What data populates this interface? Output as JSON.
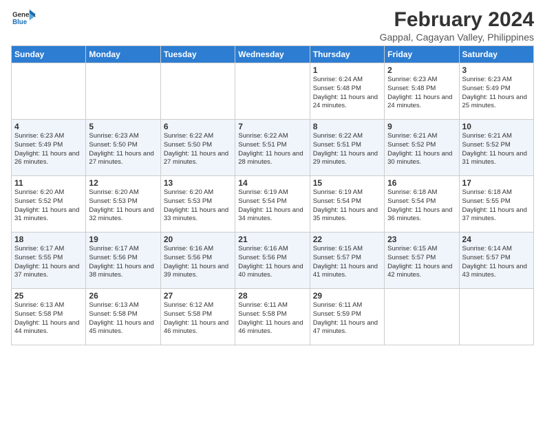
{
  "header": {
    "logo_line1": "General",
    "logo_line2": "Blue",
    "title": "February 2024",
    "subtitle": "Gappal, Cagayan Valley, Philippines"
  },
  "days_of_week": [
    "Sunday",
    "Monday",
    "Tuesday",
    "Wednesday",
    "Thursday",
    "Friday",
    "Saturday"
  ],
  "weeks": [
    [
      {
        "day": "",
        "info": ""
      },
      {
        "day": "",
        "info": ""
      },
      {
        "day": "",
        "info": ""
      },
      {
        "day": "",
        "info": ""
      },
      {
        "day": "1",
        "info": "Sunrise: 6:24 AM\nSunset: 5:48 PM\nDaylight: 11 hours and 24 minutes."
      },
      {
        "day": "2",
        "info": "Sunrise: 6:23 AM\nSunset: 5:48 PM\nDaylight: 11 hours and 24 minutes."
      },
      {
        "day": "3",
        "info": "Sunrise: 6:23 AM\nSunset: 5:49 PM\nDaylight: 11 hours and 25 minutes."
      }
    ],
    [
      {
        "day": "4",
        "info": "Sunrise: 6:23 AM\nSunset: 5:49 PM\nDaylight: 11 hours and 26 minutes."
      },
      {
        "day": "5",
        "info": "Sunrise: 6:23 AM\nSunset: 5:50 PM\nDaylight: 11 hours and 27 minutes."
      },
      {
        "day": "6",
        "info": "Sunrise: 6:22 AM\nSunset: 5:50 PM\nDaylight: 11 hours and 27 minutes."
      },
      {
        "day": "7",
        "info": "Sunrise: 6:22 AM\nSunset: 5:51 PM\nDaylight: 11 hours and 28 minutes."
      },
      {
        "day": "8",
        "info": "Sunrise: 6:22 AM\nSunset: 5:51 PM\nDaylight: 11 hours and 29 minutes."
      },
      {
        "day": "9",
        "info": "Sunrise: 6:21 AM\nSunset: 5:52 PM\nDaylight: 11 hours and 30 minutes."
      },
      {
        "day": "10",
        "info": "Sunrise: 6:21 AM\nSunset: 5:52 PM\nDaylight: 11 hours and 31 minutes."
      }
    ],
    [
      {
        "day": "11",
        "info": "Sunrise: 6:20 AM\nSunset: 5:52 PM\nDaylight: 11 hours and 31 minutes."
      },
      {
        "day": "12",
        "info": "Sunrise: 6:20 AM\nSunset: 5:53 PM\nDaylight: 11 hours and 32 minutes."
      },
      {
        "day": "13",
        "info": "Sunrise: 6:20 AM\nSunset: 5:53 PM\nDaylight: 11 hours and 33 minutes."
      },
      {
        "day": "14",
        "info": "Sunrise: 6:19 AM\nSunset: 5:54 PM\nDaylight: 11 hours and 34 minutes."
      },
      {
        "day": "15",
        "info": "Sunrise: 6:19 AM\nSunset: 5:54 PM\nDaylight: 11 hours and 35 minutes."
      },
      {
        "day": "16",
        "info": "Sunrise: 6:18 AM\nSunset: 5:54 PM\nDaylight: 11 hours and 36 minutes."
      },
      {
        "day": "17",
        "info": "Sunrise: 6:18 AM\nSunset: 5:55 PM\nDaylight: 11 hours and 37 minutes."
      }
    ],
    [
      {
        "day": "18",
        "info": "Sunrise: 6:17 AM\nSunset: 5:55 PM\nDaylight: 11 hours and 37 minutes."
      },
      {
        "day": "19",
        "info": "Sunrise: 6:17 AM\nSunset: 5:56 PM\nDaylight: 11 hours and 38 minutes."
      },
      {
        "day": "20",
        "info": "Sunrise: 6:16 AM\nSunset: 5:56 PM\nDaylight: 11 hours and 39 minutes."
      },
      {
        "day": "21",
        "info": "Sunrise: 6:16 AM\nSunset: 5:56 PM\nDaylight: 11 hours and 40 minutes."
      },
      {
        "day": "22",
        "info": "Sunrise: 6:15 AM\nSunset: 5:57 PM\nDaylight: 11 hours and 41 minutes."
      },
      {
        "day": "23",
        "info": "Sunrise: 6:15 AM\nSunset: 5:57 PM\nDaylight: 11 hours and 42 minutes."
      },
      {
        "day": "24",
        "info": "Sunrise: 6:14 AM\nSunset: 5:57 PM\nDaylight: 11 hours and 43 minutes."
      }
    ],
    [
      {
        "day": "25",
        "info": "Sunrise: 6:13 AM\nSunset: 5:58 PM\nDaylight: 11 hours and 44 minutes."
      },
      {
        "day": "26",
        "info": "Sunrise: 6:13 AM\nSunset: 5:58 PM\nDaylight: 11 hours and 45 minutes."
      },
      {
        "day": "27",
        "info": "Sunrise: 6:12 AM\nSunset: 5:58 PM\nDaylight: 11 hours and 46 minutes."
      },
      {
        "day": "28",
        "info": "Sunrise: 6:11 AM\nSunset: 5:58 PM\nDaylight: 11 hours and 46 minutes."
      },
      {
        "day": "29",
        "info": "Sunrise: 6:11 AM\nSunset: 5:59 PM\nDaylight: 11 hours and 47 minutes."
      },
      {
        "day": "",
        "info": ""
      },
      {
        "day": "",
        "info": ""
      }
    ]
  ]
}
